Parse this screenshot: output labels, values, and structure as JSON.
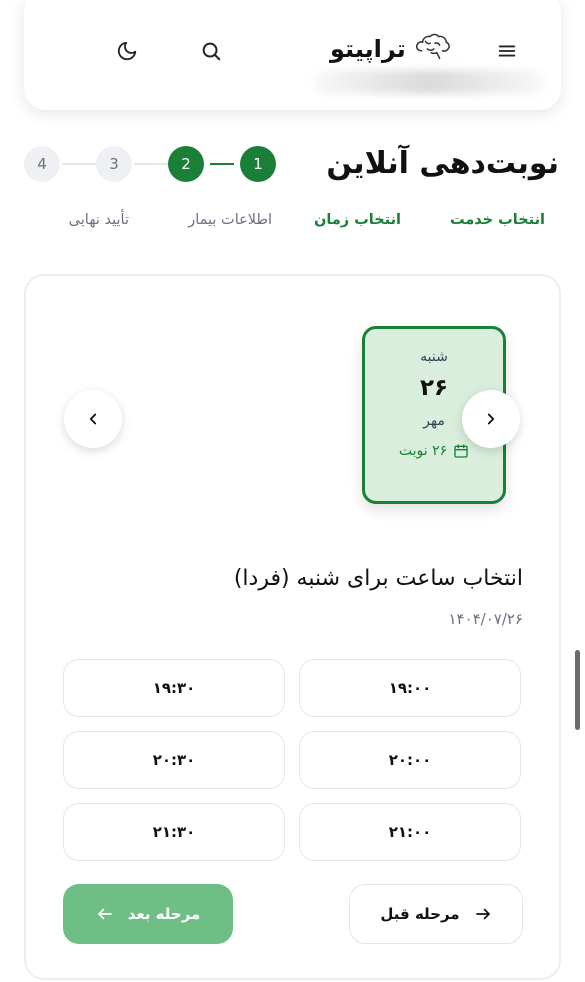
{
  "header": {
    "brand_name": "تراپیتو",
    "icons": [
      "moon-icon",
      "search-icon",
      "brain-logo-icon",
      "menu-icon"
    ]
  },
  "page": {
    "title": "نوبت‌دهی آنلاین"
  },
  "steps": {
    "numbers": [
      "1",
      "2",
      "3",
      "4"
    ],
    "labels": [
      "انتخاب خدمت",
      "انتخاب زمان",
      "اطلاعات بیمار",
      "تأیید نهایی"
    ],
    "current": 2
  },
  "day_card": {
    "day_name": "شنبه",
    "day_number": "۲۶",
    "month": "مهر",
    "appointments": "۲۶ نوبت"
  },
  "time_section": {
    "title": "انتخاب ساعت برای شنبه (فردا)",
    "date": "۱۴۰۴/۰۷/۲۶",
    "slots": [
      "۱۹:۰۰",
      "۱۹:۳۰",
      "۲۰:۰۰",
      "۲۰:۳۰",
      "۲۱:۰۰",
      "۲۱:۳۰"
    ]
  },
  "actions": {
    "next_label": "مرحله بعد",
    "prev_label": "مرحله قبل"
  },
  "colors": {
    "primary": "#1a7f37",
    "primary_light": "#d9eedd",
    "button_disabled": "#6fbe86",
    "step_inactive": "#eef0f4"
  }
}
